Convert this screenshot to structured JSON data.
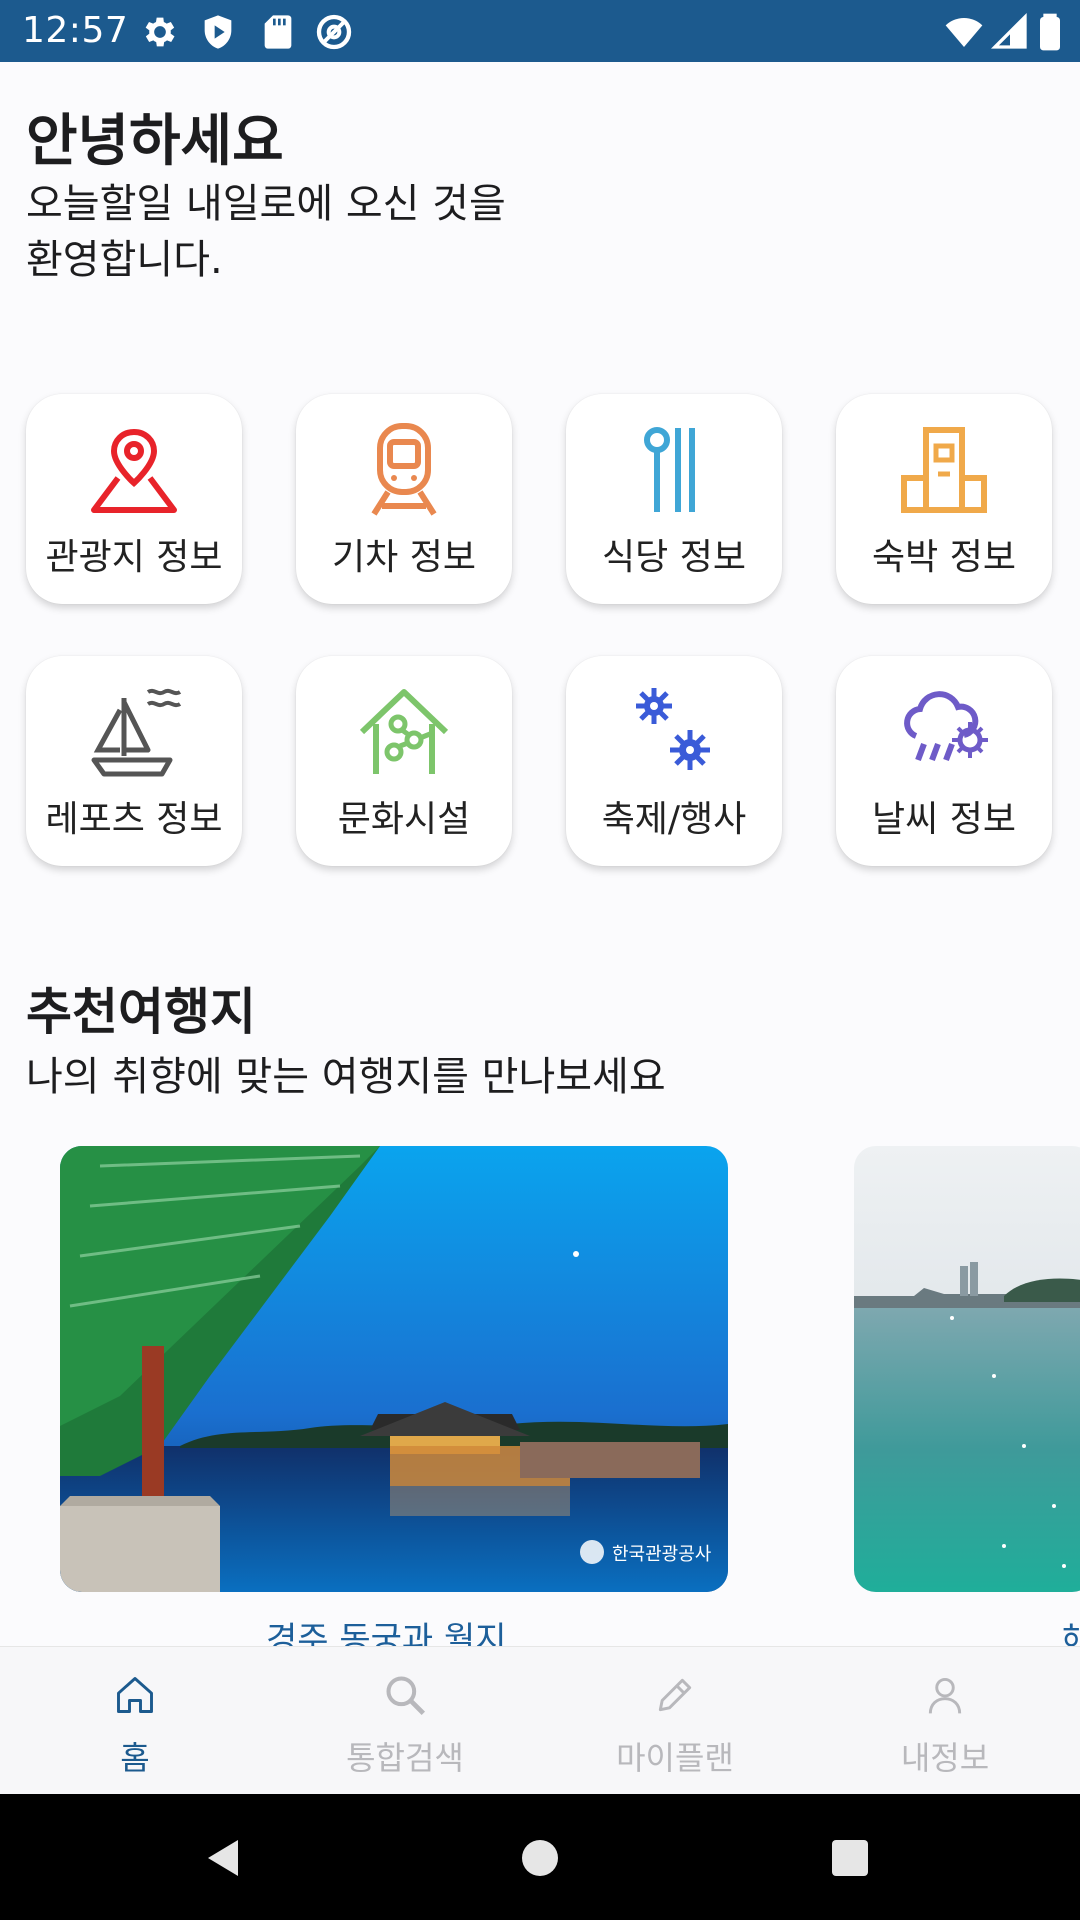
{
  "status_bar": {
    "time": "12:57",
    "left_icons": [
      "gear-icon",
      "shield-icon",
      "sd-card-icon",
      "at-sign-icon"
    ],
    "right_icons": [
      "wifi-icon",
      "signal-icon",
      "battery-icon"
    ],
    "background": "#1c5a8e"
  },
  "greeting": {
    "title": "안녕하세요",
    "subtitle_line1": "오늘할일 내일로에 오신 것을",
    "subtitle_line2": "환영합니다."
  },
  "categories": [
    {
      "label": "관광지 정보",
      "icon": "map-pin-icon",
      "color": "#e8232a"
    },
    {
      "label": "기차 정보",
      "icon": "train-icon",
      "color": "#e9884f"
    },
    {
      "label": "식당 정보",
      "icon": "cutlery-icon",
      "color": "#3fa6d6"
    },
    {
      "label": "숙박 정보",
      "icon": "building-icon",
      "color": "#f0a94a"
    },
    {
      "label": "레포츠 정보",
      "icon": "sailboat-icon",
      "color": "#555555"
    },
    {
      "label": "문화시설",
      "icon": "culture-house-icon",
      "color": "#7dc56b"
    },
    {
      "label": "축제/행사",
      "icon": "festival-sparkle-icon",
      "color": "#3a5bd8"
    },
    {
      "label": "날씨 정보",
      "icon": "weather-cloud-icon",
      "color": "#6e5bc8"
    }
  ],
  "recommend": {
    "title": "추천여행지",
    "subtitle": "나의 취향에 맞는 여행지를 만나보세요",
    "cards": [
      {
        "caption": "경주 동궁과 월지",
        "image": "night-palace-pond-photo",
        "watermark": "한국관광공사"
      },
      {
        "caption": "해",
        "image": "beach-sea-photo"
      }
    ]
  },
  "bottom_nav": {
    "items": [
      {
        "label": "홈",
        "icon": "home-icon",
        "active": true
      },
      {
        "label": "통합검색",
        "icon": "search-icon",
        "active": false
      },
      {
        "label": "마이플랜",
        "icon": "pencil-icon",
        "active": false
      },
      {
        "label": "내정보",
        "icon": "person-icon",
        "active": false
      }
    ],
    "active_color": "#1c5a8e",
    "inactive_color": "#b8b8bc"
  },
  "system_nav": {
    "buttons": [
      "back-icon",
      "home-circle-icon",
      "recents-icon"
    ]
  }
}
